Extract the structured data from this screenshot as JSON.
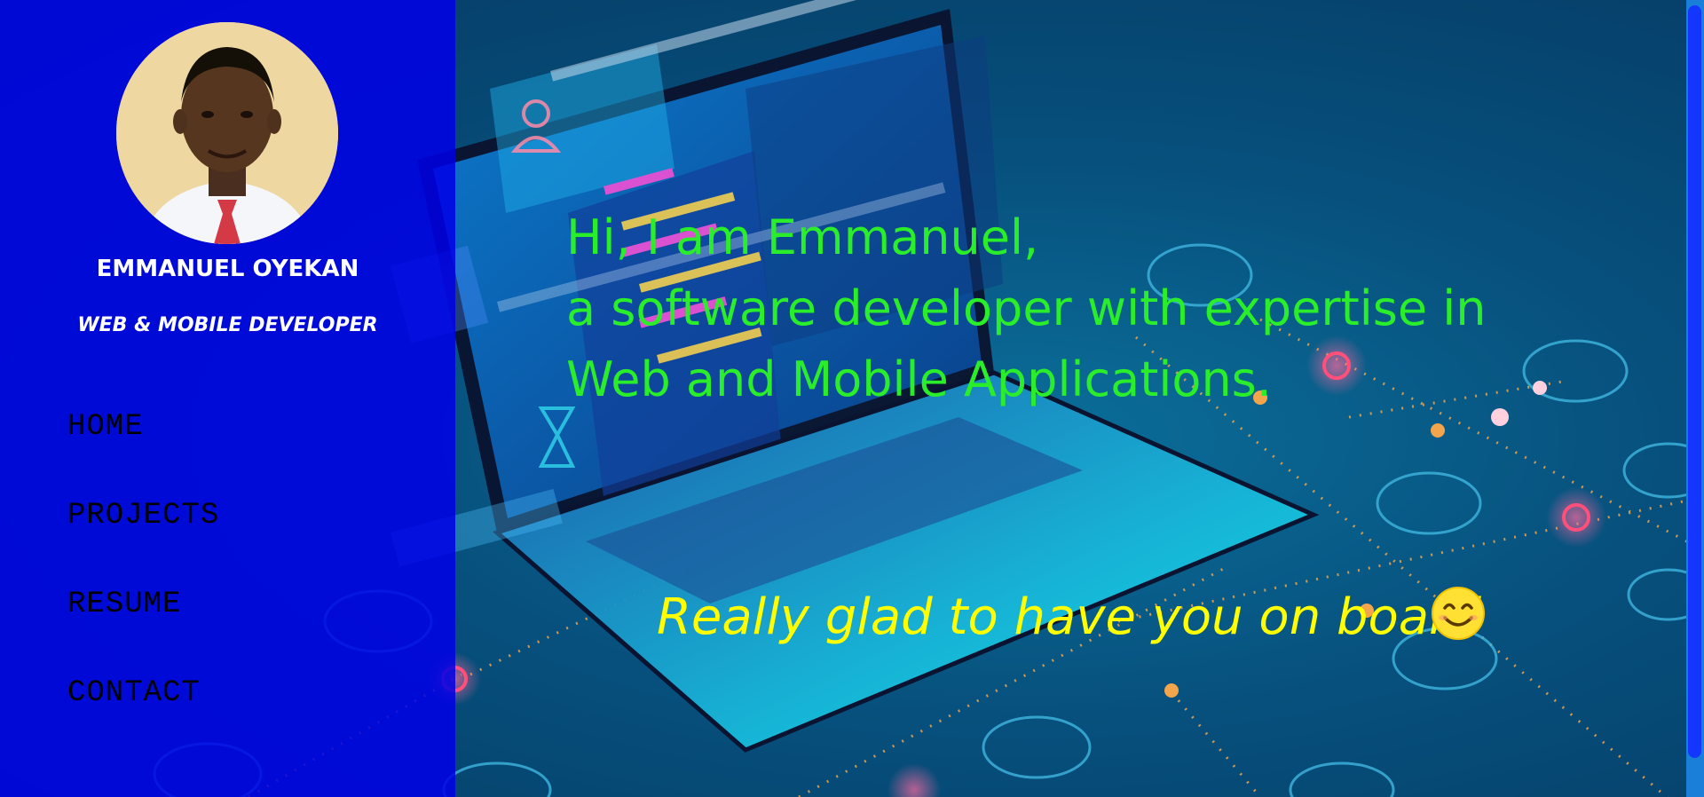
{
  "profile": {
    "name": "EMMANUEL OYEKAN",
    "role": "WEB & MOBILE DEVELOPER"
  },
  "nav": {
    "items": [
      {
        "label": "HOME"
      },
      {
        "label": "PROJECTS"
      },
      {
        "label": "RESUME"
      },
      {
        "label": "CONTACT"
      }
    ]
  },
  "hero": {
    "intro_lines": [
      "Hi, I am Emmanuel,",
      "a software developer with expertise in",
      "Web and Mobile Applications."
    ],
    "welcome": "Really glad to have you on board"
  },
  "icons": {
    "welcome_emoji": "smiling-face-icon"
  },
  "colors": {
    "sidebar": "#0000e6",
    "intro_text": "#2aee2a",
    "welcome_text": "#ffff00",
    "nav_text": "#000000",
    "profile_text": "#ffffff"
  }
}
